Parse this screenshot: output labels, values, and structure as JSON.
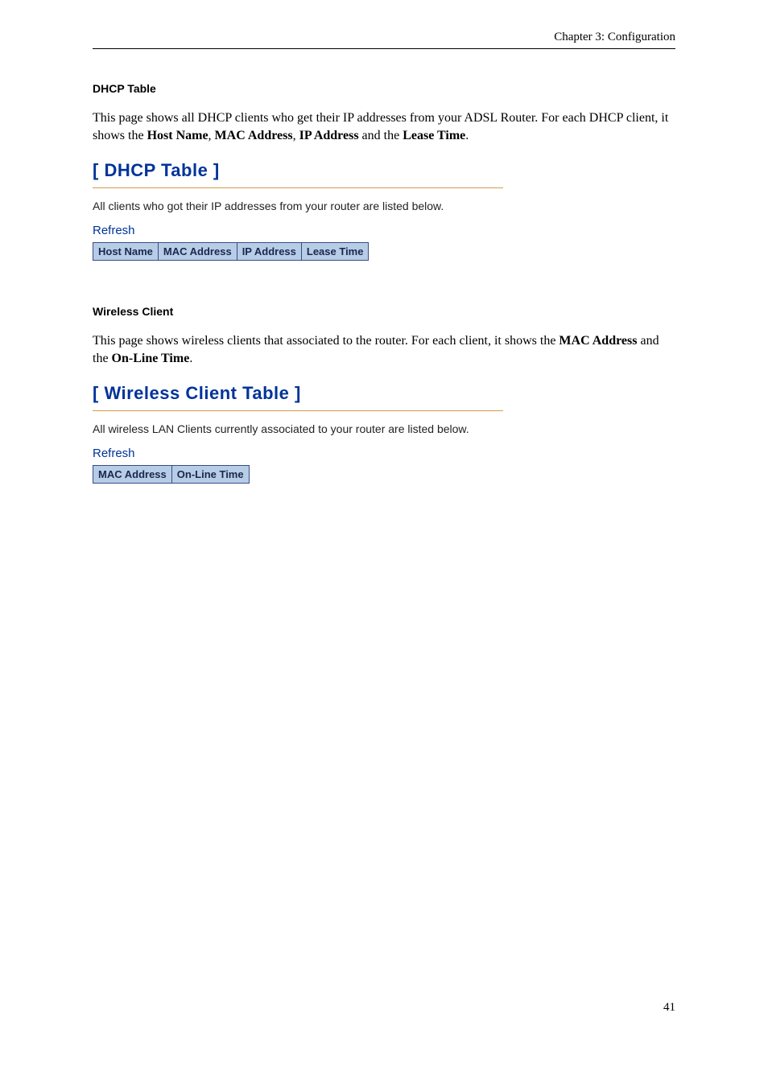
{
  "header": {
    "chapter": "Chapter 3: Configuration"
  },
  "section1": {
    "title": "DHCP Table",
    "paragraph_prefix": "This page shows all DHCP clients who get their IP addresses from your ADSL Router. For each DHCP client, it shows the ",
    "bold1": "Host Name",
    "sep1": ", ",
    "bold2": "MAC Address",
    "sep2": ", ",
    "bold3": "IP Address",
    "sep3": " and the ",
    "bold4": "Lease Time",
    "suffix": "."
  },
  "router1": {
    "title": "[ DHCP Table ]",
    "desc": "All clients who got their IP addresses from your router are listed below.",
    "refresh": "Refresh",
    "cols": {
      "c0": "Host Name",
      "c1": "MAC Address",
      "c2": "IP Address",
      "c3": "Lease Time"
    }
  },
  "section2": {
    "title": "Wireless Client",
    "paragraph_prefix": "This page shows wireless clients that associated to the router. For each client, it shows the ",
    "bold1": "MAC Address",
    "sep1": " and the ",
    "bold2": "On-Line Time",
    "suffix": "."
  },
  "router2": {
    "title": "[ Wireless Client Table ]",
    "desc": "All wireless LAN Clients currently associated to your router are listed below.",
    "refresh": "Refresh",
    "cols": {
      "c0": "MAC Address",
      "c1": "On-Line Time"
    }
  },
  "page_number": "41"
}
